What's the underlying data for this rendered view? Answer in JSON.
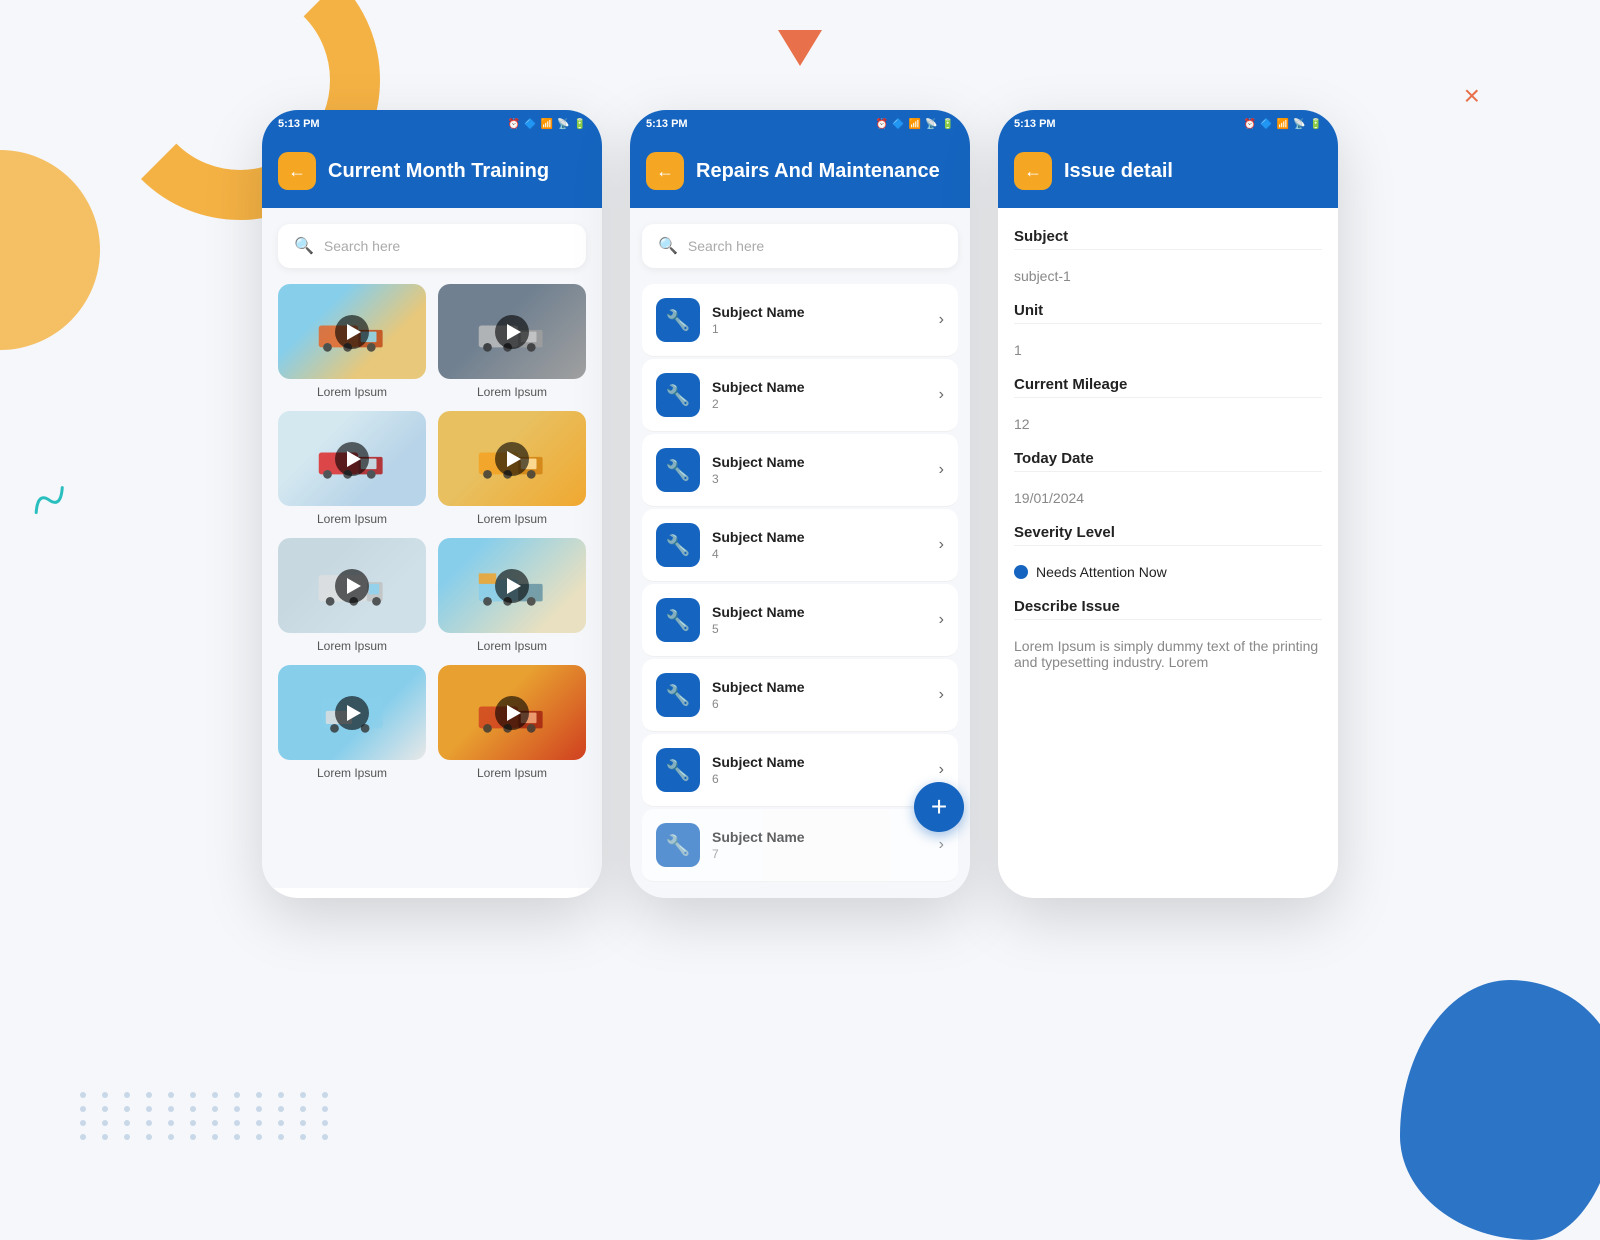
{
  "decorative": {
    "close_label": "×",
    "squiggle": "~"
  },
  "screen1": {
    "status_time": "5:13 PM",
    "header_title": "Current Month Training",
    "back_label": "←",
    "search_placeholder": "Search here",
    "videos": [
      {
        "label": "Lorem Ipsum",
        "thumb": 1
      },
      {
        "label": "Lorem Ipsum",
        "thumb": 2
      },
      {
        "label": "Lorem Ipsum",
        "thumb": 3
      },
      {
        "label": "Lorem Ipsum",
        "thumb": 4
      },
      {
        "label": "Lorem Ipsum",
        "thumb": 5
      },
      {
        "label": "Lorem Ipsum",
        "thumb": 6
      },
      {
        "label": "Lorem Ipsum",
        "thumb": 7
      },
      {
        "label": "Lorem Ipsum",
        "thumb": 8
      }
    ]
  },
  "screen2": {
    "status_time": "5:13 PM",
    "header_title": "Repairs And Maintenance",
    "back_label": "←",
    "search_placeholder": "Search here",
    "items": [
      {
        "name": "Subject Name",
        "num": "1"
      },
      {
        "name": "Subject Name",
        "num": "2"
      },
      {
        "name": "Subject Name",
        "num": "3"
      },
      {
        "name": "Subject Name",
        "num": "4"
      },
      {
        "name": "Subject Name",
        "num": "5"
      },
      {
        "name": "Subject Name",
        "num": "6"
      },
      {
        "name": "Subject Name",
        "num": "6"
      },
      {
        "name": "Subject Name",
        "num": "7"
      }
    ],
    "fab_label": "+"
  },
  "screen3": {
    "status_time": "5:13 PM",
    "header_title": "Issue detail",
    "back_label": "←",
    "fields": {
      "subject_label": "Subject",
      "subject_value": "subject-1",
      "unit_label": "Unit",
      "unit_value": "1",
      "mileage_label": "Current Mileage",
      "mileage_value": "12",
      "date_label": "Today Date",
      "date_value": "19/01/2024",
      "severity_label": "Severity Level",
      "severity_value": "Needs Attention Now",
      "describe_label": "Describe Issue",
      "describe_value": "Lorem Ipsum is simply dummy text of the printing and typesetting industry. Lorem"
    }
  }
}
